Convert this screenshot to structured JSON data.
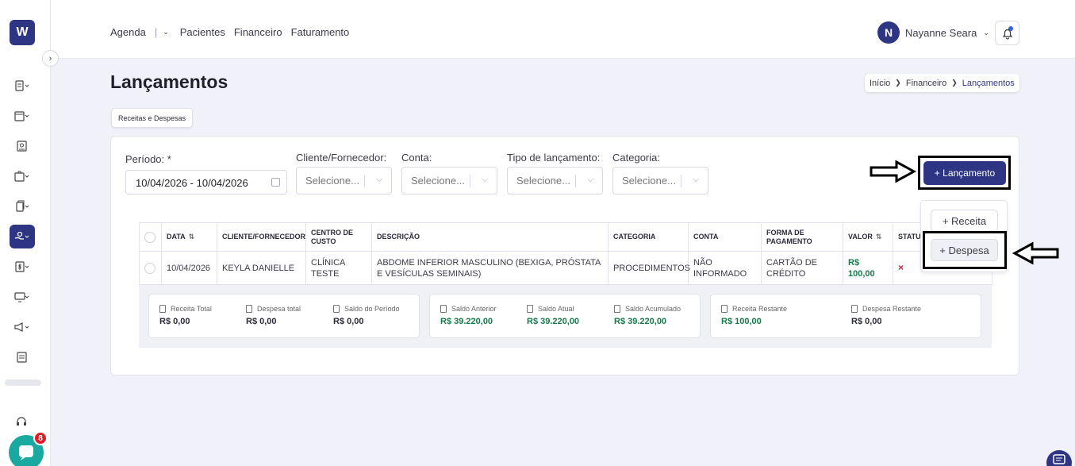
{
  "app": {
    "logo_letter": "W"
  },
  "topnav": {
    "agenda": "Agenda",
    "pacientes": "Pacientes",
    "financeiro": "Financeiro",
    "faturamento": "Faturamento"
  },
  "user": {
    "initial": "N",
    "name": "Nayanne Seara"
  },
  "page": {
    "title": "Lançamentos",
    "tab": "Receitas e Despesas"
  },
  "breadcrumb": {
    "home": "Início",
    "section": "Financeiro",
    "current": "Lançamentos"
  },
  "filters": {
    "periodo_label": "Período: *",
    "periodo_value": "10/04/2026 - 10/04/2026",
    "cliente_label": "Cliente/Fornecedor:",
    "conta_label": "Conta:",
    "tipo_label": "Tipo de lançamento:",
    "categoria_label": "Categoria:",
    "placeholder": "Selecione..."
  },
  "actions": {
    "lancamento": "+ Lançamento",
    "receita": "+ Receita",
    "despesa": "+ Despesa"
  },
  "table": {
    "headers": [
      "DATA",
      "CLIENTE/FORNECEDOR",
      "CENTRO DE CUSTO",
      "DESCRIÇÃO",
      "CATEGORIA",
      "CONTA",
      "FORMA DE PAGAMENTO",
      "VALOR",
      "STATU"
    ],
    "rows": [
      {
        "data": "10/04/2026",
        "cliente": "KEYLA DANIELLE",
        "centro": "CLÍNICA TESTE",
        "descricao": "ABDOME INFERIOR MASCULINO (BEXIGA, PRÓSTATA E VESÍCULAS SEMINAIS)",
        "categoria": "PROCEDIMENTOS",
        "conta": "NÃO INFORMADO",
        "forma": "CARTÃO DE CRÉDITO",
        "valor": "R$ 100,00",
        "status": "×"
      }
    ]
  },
  "summary": {
    "receita_total_label": "Receita Total",
    "receita_total": "R$ 0,00",
    "despesa_total_label": "Despesa total",
    "despesa_total": "R$ 0,00",
    "saldo_periodo_label": "Saldo do Período",
    "saldo_periodo": "R$ 0,00",
    "saldo_anterior_label": "Saldo Anterior",
    "saldo_anterior": "R$ 39.220,00",
    "saldo_atual_label": "Saldo Atual",
    "saldo_atual": "R$ 39.220,00",
    "saldo_acumulado_label": "Saldo Acumulado",
    "saldo_acumulado": "R$ 39.220,00",
    "receita_restante_label": "Receita Restante",
    "receita_restante": "R$ 100,00",
    "despesa_restante_label": "Despesa Restante",
    "despesa_restante": "R$ 0,00"
  },
  "chat": {
    "badge": "8"
  },
  "colors": {
    "primary": "#2e3683",
    "positive": "#16794b",
    "danger": "#d02a38",
    "chat": "#19a9a0"
  }
}
